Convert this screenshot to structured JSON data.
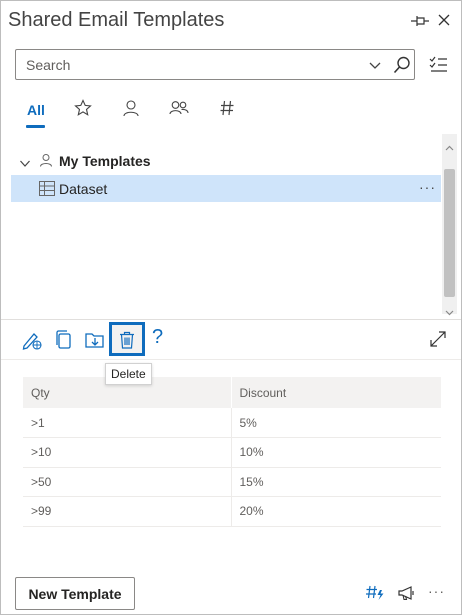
{
  "window": {
    "title": "Shared Email Templates"
  },
  "search": {
    "placeholder": "Search"
  },
  "tabs": {
    "all_label": "All"
  },
  "tree": {
    "group": {
      "label": "My Templates"
    },
    "selected_item": {
      "label": "Dataset",
      "more": "···"
    }
  },
  "toolbar": {
    "help_label": "?",
    "tooltip": "Delete"
  },
  "preview": {
    "headers": [
      "Qty",
      "Discount"
    ],
    "rows": [
      [
        ">1",
        "5%"
      ],
      [
        ">10",
        "10%"
      ],
      [
        ">50",
        "15%"
      ],
      [
        ">99",
        "20%"
      ]
    ]
  },
  "bottom": {
    "new_template_label": "New Template",
    "more": "···"
  },
  "colors": {
    "accent": "#0f6cbd",
    "selected_row": "#cfe4fa",
    "header_bg": "#f3f2f1"
  }
}
